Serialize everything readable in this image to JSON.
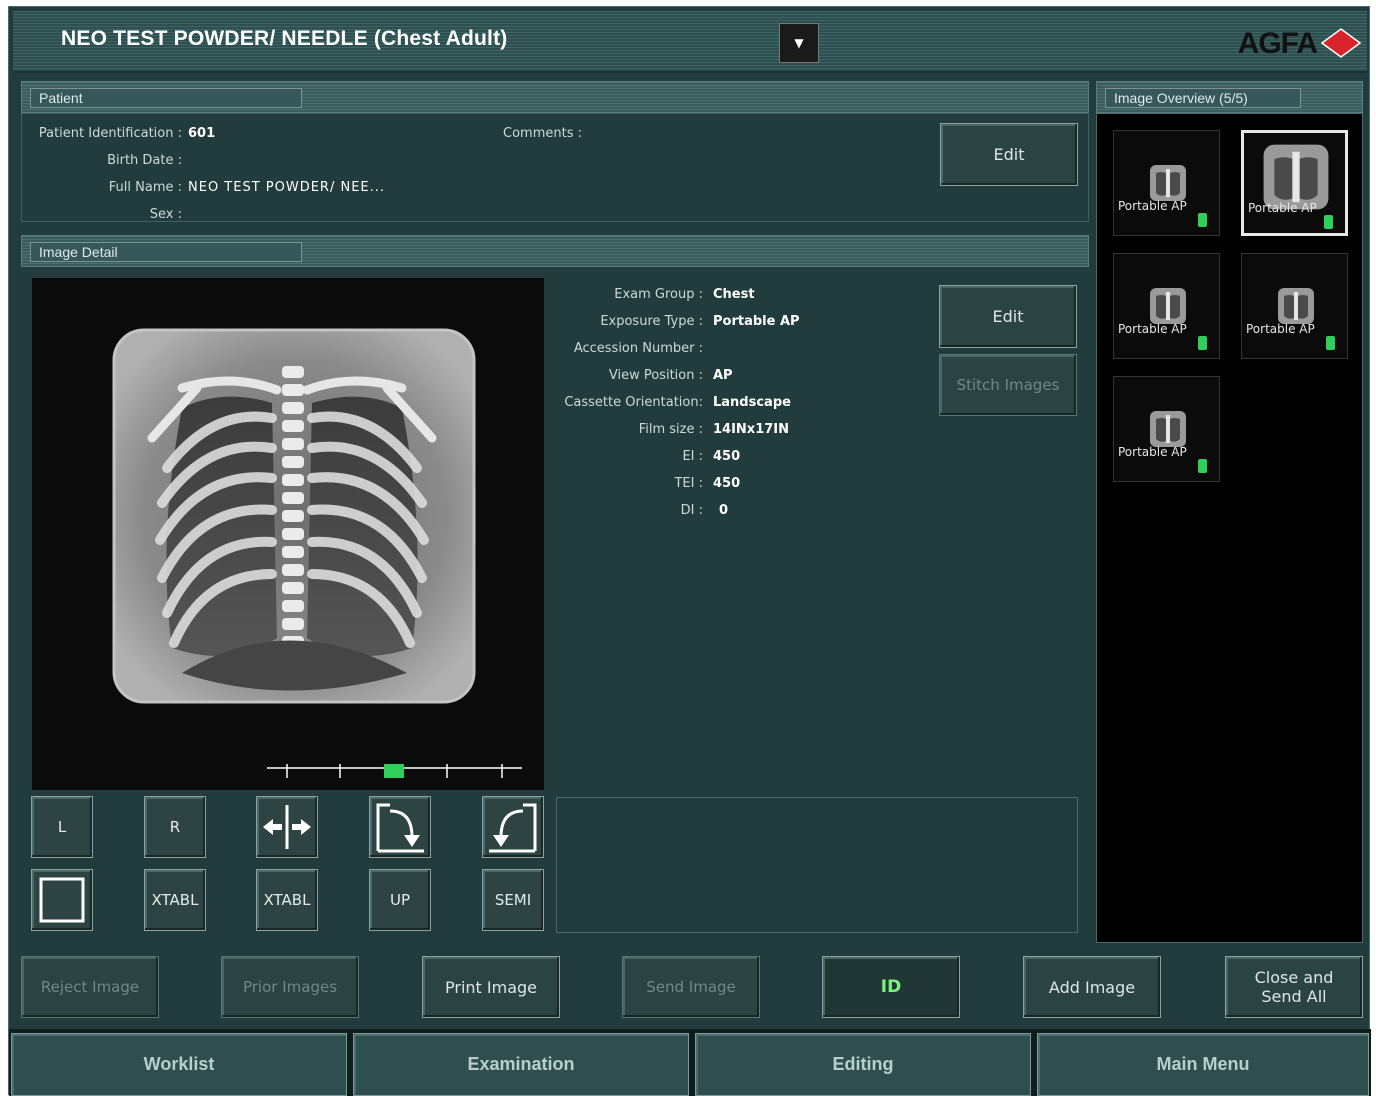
{
  "title": {
    "text": "NEO TEST POWDER/ NEEDLE (Chest Adult)",
    "dropdown_icon": "caret-down-icon",
    "brand": "AGFA",
    "brand_badge": "Agfa"
  },
  "patient": {
    "header": "Patient",
    "fields": [
      {
        "label": "Patient Identification :",
        "value": "601"
      },
      {
        "label": "Birth Date :",
        "value": ""
      },
      {
        "label": "Full Name :",
        "value": "NEO TEST POWDER/ NEE..."
      },
      {
        "label": "Sex :",
        "value": ""
      }
    ],
    "comments_label": "Comments :",
    "edit_label": "Edit"
  },
  "image_detail": {
    "header": "Image Detail",
    "fields": [
      {
        "label": "Exam Group :",
        "value": "Chest"
      },
      {
        "label": "Exposure Type :",
        "value": "Portable AP"
      },
      {
        "label": "Accession Number :",
        "value": ""
      },
      {
        "label": "View Position :",
        "value": "AP"
      },
      {
        "label": "Cassette Orientation:",
        "value": "Landscape"
      },
      {
        "label": "Film size :",
        "value": "14INx17IN"
      },
      {
        "label": "EI :",
        "value": "450"
      },
      {
        "label": "TEI :",
        "value": "450"
      },
      {
        "label": "DI :",
        "value": "0"
      }
    ],
    "edit_label": "Edit",
    "stitch_label": "Stitch Images"
  },
  "tools": {
    "row1": [
      {
        "label": "L",
        "icon": ""
      },
      {
        "label": "R",
        "icon": ""
      },
      {
        "label": "",
        "icon": "flip-horizontal-icon"
      },
      {
        "label": "",
        "icon": "rotate-clockwise-icon"
      },
      {
        "label": "",
        "icon": "rotate-counterclockwise-icon"
      }
    ],
    "row2": [
      {
        "label": "",
        "icon": "collimation-square-icon"
      },
      {
        "label": "XTABL",
        "icon": ""
      },
      {
        "label": "XTABL",
        "icon": ""
      },
      {
        "label": "UP",
        "icon": ""
      },
      {
        "label": "SEMI",
        "icon": ""
      }
    ]
  },
  "overview": {
    "header": "Image Overview (5/5)",
    "thumbnails": [
      {
        "label": "Portable AP",
        "selected": false
      },
      {
        "label": "Portable AP",
        "selected": true
      },
      {
        "label": "Portable AP",
        "selected": false
      },
      {
        "label": "Portable AP",
        "selected": false
      },
      {
        "label": "Portable AP",
        "selected": false
      }
    ]
  },
  "actions": {
    "reject": "Reject Image",
    "prior": "Prior Images",
    "print": "Print Image",
    "send": "Send Image",
    "id": "ID",
    "add": "Add Image",
    "close_send": "Close and Send All"
  },
  "nav": {
    "worklist": "Worklist",
    "examination": "Examination",
    "editing": "Editing",
    "main_menu": "Main Menu"
  },
  "colors": {
    "background": "#223c3d",
    "id_accent": "#7cf27c",
    "qa_ok": "#2fd05a",
    "brand_red": "#d8232a"
  }
}
